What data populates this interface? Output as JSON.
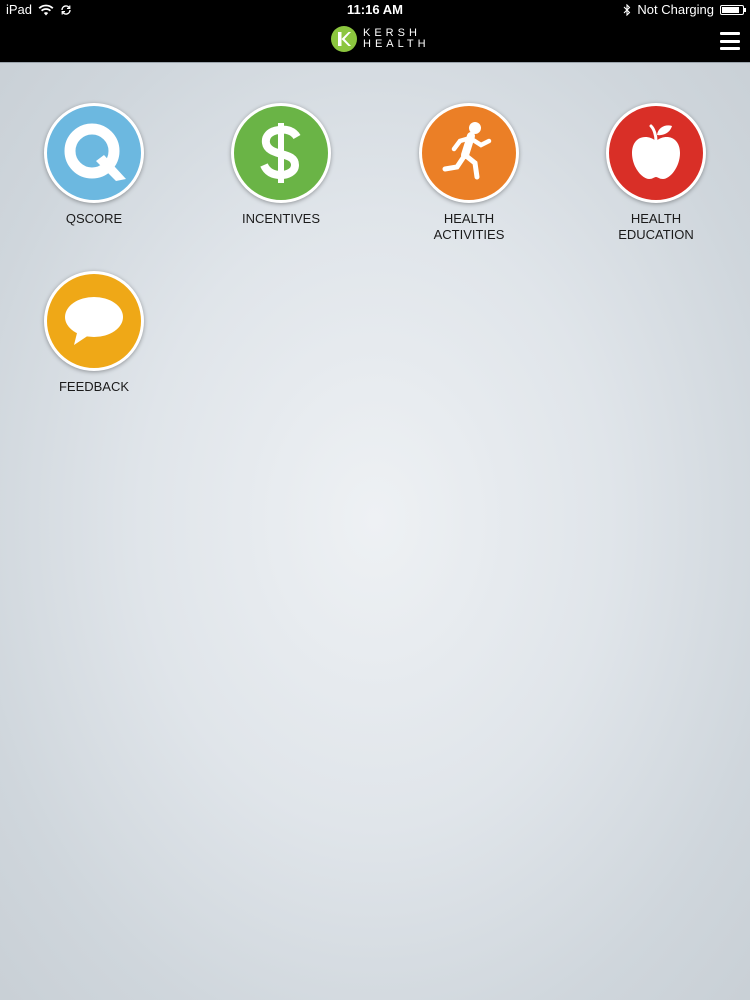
{
  "status_bar": {
    "device": "iPad",
    "time": "11:16 AM",
    "charging_status": "Not Charging",
    "battery_level_percent": 85,
    "icons": [
      "wifi-icon",
      "sync-icon",
      "bluetooth-icon",
      "battery-icon"
    ]
  },
  "header": {
    "logo_letter": "K",
    "logo_line1": "KERSH",
    "logo_line2": "HEALTH",
    "logo_color": "#8cc63f",
    "menu_icon": "hamburger-menu-icon"
  },
  "tiles": [
    {
      "id": "qscore",
      "label": "QSCORE",
      "color": "#6cb8e0",
      "icon": "q-icon"
    },
    {
      "id": "incentives",
      "label": "INCENTIVES",
      "color": "#6ab446",
      "icon": "dollar-icon"
    },
    {
      "id": "health-activities",
      "label": "HEALTH\nACTIVITIES",
      "color": "#eb7f26",
      "icon": "runner-icon"
    },
    {
      "id": "health-education",
      "label": "HEALTH\nEDUCATION",
      "color": "#d92f27",
      "icon": "apple-icon"
    },
    {
      "id": "feedback",
      "label": "FEEDBACK",
      "color": "#efa817",
      "icon": "speech-bubble-icon"
    }
  ]
}
